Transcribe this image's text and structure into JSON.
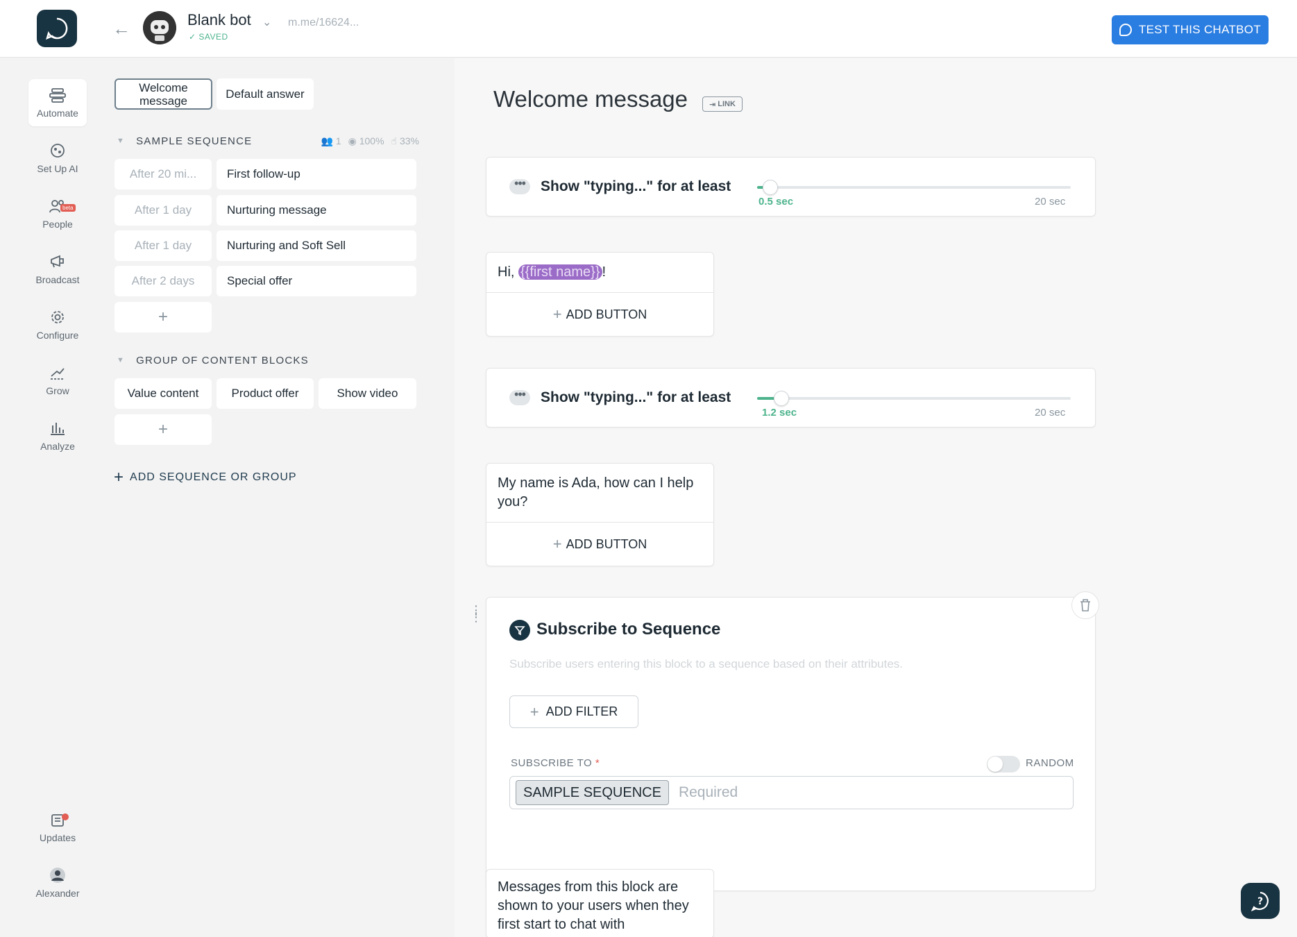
{
  "header": {
    "bot_name": "Blank bot",
    "saved_label": "SAVED",
    "bot_link": "m.me/16624...",
    "test_button": "TEST THIS CHATBOT"
  },
  "nav": {
    "automate": "Automate",
    "setup_ai": "Set Up AI",
    "people": "People",
    "people_badge": "beta",
    "broadcast": "Broadcast",
    "configure": "Configure",
    "grow": "Grow",
    "analyze": "Analyze",
    "updates": "Updates",
    "user": "Alexander"
  },
  "panel": {
    "tab_welcome": "Welcome message",
    "tab_default": "Default answer",
    "sample_sequence": {
      "title": "SAMPLE SEQUENCE",
      "stat_users": "1",
      "stat_views": "100%",
      "stat_clicks": "33%",
      "items": [
        {
          "delay": "After 20 mi...",
          "name": "First follow-up"
        },
        {
          "delay": "After 1 day",
          "name": "Nurturing message"
        },
        {
          "delay": "After 1 day",
          "name": "Nurturing and Soft Sell"
        },
        {
          "delay": "After 2 days",
          "name": "Special offer"
        }
      ],
      "add": "+"
    },
    "group": {
      "title": "GROUP OF CONTENT BLOCKS",
      "blocks": [
        "Value content",
        "Product offer",
        "Show video"
      ],
      "add": "+"
    },
    "add_sequence": "ADD SEQUENCE OR GROUP"
  },
  "content": {
    "title": "Welcome message",
    "link_badge": "LINK",
    "typing1": {
      "label": "Show \"typing...\" for at least",
      "value": "0.5 sec",
      "max": "20 sec",
      "fraction": 0.025
    },
    "message1": {
      "prefix": "Hi, ",
      "variable": "{{first name}}",
      "suffix": "!",
      "add_button": "ADD BUTTON"
    },
    "typing2": {
      "label": "Show \"typing...\" for at least",
      "value": "1.2 sec",
      "max": "20 sec",
      "fraction": 0.06
    },
    "message2": {
      "text": "My name is Ada, how can I help you?",
      "add_button": "ADD BUTTON"
    },
    "subscribe": {
      "title": "Subscribe to Sequence",
      "description": "Subscribe users entering this block to a sequence based on their attributes.",
      "add_filter": "ADD FILTER",
      "subscribe_to": "SUBSCRIBE TO",
      "required_mark": "*",
      "random": "RANDOM",
      "chip": "SAMPLE SEQUENCE",
      "placeholder": "Required"
    },
    "info": {
      "text": "Messages from this block are shown to your users when they first start to chat with"
    }
  }
}
